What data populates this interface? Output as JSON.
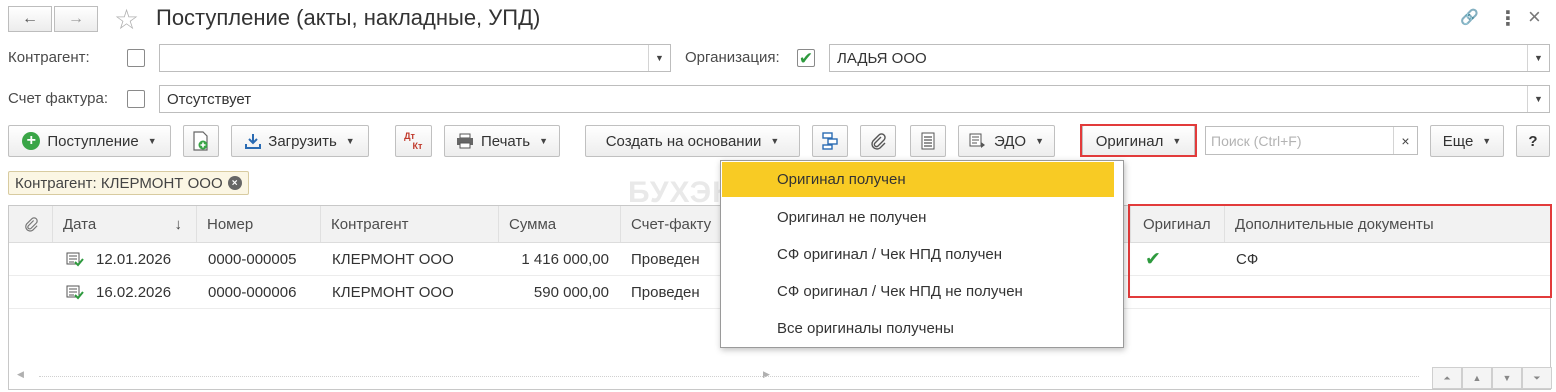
{
  "window": {
    "title": "Поступление (акты, накладные, УПД)",
    "back_icon": "←",
    "forward_icon": "→",
    "star_icon": "☆",
    "link_icon": "🔗",
    "menu_icon": "⋮",
    "close_icon": "×"
  },
  "filters": {
    "contractor_label": "Контрагент:",
    "contractor_value": "",
    "organization_label": "Организация:",
    "organization_value": "ЛАДЬЯ ООО",
    "invoice_label": "Счет фактура:",
    "invoice_value": "Отсутствует"
  },
  "toolbar": {
    "receipt_label": "Поступление",
    "load_label": "Загрузить",
    "dtkt_label_top": "Дт",
    "dtkt_label_bottom": "Кт",
    "print_label": "Печать",
    "create_based_label": "Создать на основании",
    "edo_label": "ЭДО",
    "original_label": "Оригинал",
    "search_placeholder": "Поиск (Ctrl+F)",
    "search_clear": "×",
    "more_label": "Еще",
    "help_label": "?"
  },
  "filter_tag": {
    "label": "Контрагент: КЛЕРМОНТ ООО",
    "remove": "×"
  },
  "watermark": "БУХЭКСПЕРТ",
  "table": {
    "columns": {
      "date": "Дата",
      "sort_arrow": "↓",
      "number": "Номер",
      "contractor": "Контрагент",
      "sum": "Сумма",
      "invoice": "Счет-факту",
      "original": "Оригинал",
      "extra_docs": "Дополнительные документы"
    },
    "rows": [
      {
        "date": "12.01.2026",
        "number": "0000-000005",
        "contractor": "КЛЕРМОНТ ООО",
        "sum": "1 416 000,00",
        "invoice": "Проведен",
        "original": "✔",
        "extra_docs": "СФ"
      },
      {
        "date": "16.02.2026",
        "number": "0000-000006",
        "contractor": "КЛЕРМОНТ ООО",
        "sum": "590 000,00",
        "invoice": "Проведен",
        "original": "",
        "extra_docs": ""
      }
    ]
  },
  "original_menu": {
    "items": [
      "Оригинал получен",
      "Оригинал не получен",
      "СФ оригинал / Чек НПД получен",
      "СФ оригинал / Чек НПД не получен",
      "Все оригиналы получены"
    ],
    "selected_index": 0
  },
  "colors": {
    "highlight": "#f8cb24",
    "annotation_red": "#e23b3b",
    "check_green": "#2e9a3e"
  }
}
